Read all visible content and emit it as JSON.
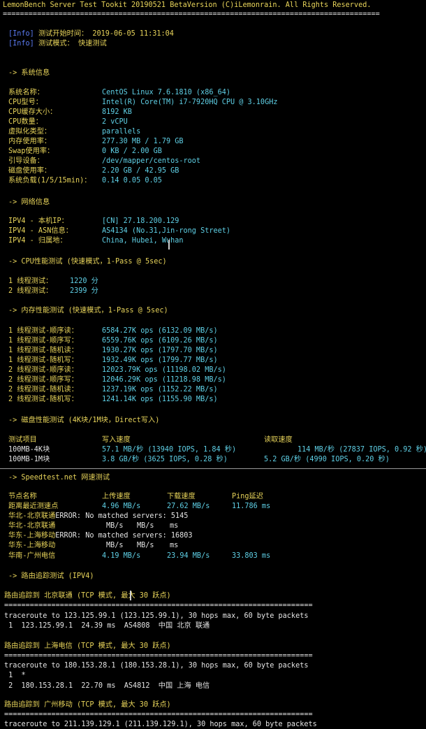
{
  "header": {
    "banner": "LemonBench Server Test Tookit 20190521 BetaVersion (C)iLemonrain. All Rights Reserved.",
    "divider": "========================================================================================"
  },
  "info": {
    "tag": "[Info] ",
    "start_label": "测试开始时间： ",
    "start_value": "2019-06-05 11:31:04",
    "mode_label": "测试模式： ",
    "mode_value": "快速测试"
  },
  "system": {
    "heading": "-> 系统信息",
    "rows": [
      {
        "label": "系统名称：",
        "value": "CentOS Linux 7.6.1810 (x86_64)"
      },
      {
        "label": "CPU型号：",
        "value": "Intel(R) Core(TM) i7-7920HQ CPU @ 3.10GHz"
      },
      {
        "label": "CPU缓存大小：",
        "value": "8192 KB"
      },
      {
        "label": "CPU数量：",
        "value": "2 vCPU"
      },
      {
        "label": "虚拟化类型：",
        "value": "parallels"
      },
      {
        "label": "内存使用率：",
        "value": "277.30 MB / 1.79 GB"
      },
      {
        "label": "Swap使用率：",
        "value": "0 KB / 2.00 GB"
      },
      {
        "label": "引导设备：",
        "value": "/dev/mapper/centos-root"
      },
      {
        "label": "磁盘使用率：",
        "value": "2.20 GB / 42.95 GB"
      },
      {
        "label": "系统负载(1/5/15min)：",
        "value": "0.14 0.05 0.05"
      }
    ]
  },
  "network": {
    "heading": "-> 网络信息",
    "rows": [
      {
        "label": "IPV4 - 本机IP：",
        "value": "[CN] 27.18.200.129"
      },
      {
        "label": "IPV4 - ASN信息：",
        "value": "AS4134 (No.31,Jin-rong Street)"
      },
      {
        "label": "IPV4 - 归属地：",
        "value": "China, Hubei, Wuhan"
      }
    ]
  },
  "cpu": {
    "heading": "-> CPU性能测试 (快速模式，1-Pass @ 5sec)",
    "rows": [
      {
        "label": "1 线程测试：",
        "value": "1220 分"
      },
      {
        "label": "2 线程测试：",
        "value": "2399 分"
      }
    ]
  },
  "memory": {
    "heading": "-> 内存性能测试 (快速模式，1-Pass @ 5sec)",
    "rows": [
      {
        "label": "1 线程测试-顺序读：",
        "value": "6584.27K ops (6132.09 MB/s)"
      },
      {
        "label": "1 线程测试-顺序写：",
        "value": "6559.76K ops (6109.26 MB/s)"
      },
      {
        "label": "1 线程测试-随机读：",
        "value": "1930.27K ops (1797.70 MB/s)"
      },
      {
        "label": "1 线程测试-随机写：",
        "value": "1932.49K ops (1799.77 MB/s)"
      },
      {
        "label": "2 线程测试-顺序读：",
        "value": "12023.79K ops (11198.02 MB/s)"
      },
      {
        "label": "2 线程测试-顺序写：",
        "value": "12046.29K ops (11218.98 MB/s)"
      },
      {
        "label": "2 线程测试-随机读：",
        "value": "1237.19K ops (1152.22 MB/s)"
      },
      {
        "label": "2 线程测试-随机写：",
        "value": "1241.14K ops (1155.90 MB/s)"
      }
    ]
  },
  "disk": {
    "heading": "-> 磁盘性能测试 (4K块/1M块，Direct写入)",
    "headers": [
      "测试项目",
      "写入速度",
      "读取速度"
    ],
    "rows": [
      {
        "item": "100MB-4K块",
        "write": "57.1 MB/秒 (13940 IOPS, 1.84 秒)",
        "read": "114 MB/秒 (27837 IOPS, 0.92 秒)"
      },
      {
        "item": "100MB-1M块",
        "write": "3.8 GB/秒 (3625 IOPS, 0.28 秒)",
        "read": "5.2 GB/秒 (4990 IOPS, 0.20 秒)"
      }
    ]
  },
  "speedtest": {
    "heading": "-> Speedtest.net 网速测试",
    "headers": [
      "节点名称",
      "上传速度",
      "下载速度",
      "Ping延迟"
    ],
    "rows": [
      {
        "node": "距离最近测速点",
        "upload": "4.96 MB/s",
        "download": "27.62 MB/s",
        "ping": "11.786 ms"
      },
      {
        "node": "华北-北京联通",
        "error": "ERROR: No matched servers: 5145"
      },
      {
        "node": "华北-北京联通",
        "upload": "MB/s",
        "download": "MB/s",
        "ping": "ms"
      },
      {
        "node": "华东-上海移动",
        "error": "ERROR: No matched servers: 16803"
      },
      {
        "node": "华东-上海移动",
        "upload": "MB/s",
        "download": "MB/s",
        "ping": "ms"
      },
      {
        "node": "华南-广州电信",
        "upload": "4.19 MB/s",
        "download": "23.94 MB/s",
        "ping": "33.803 ms"
      }
    ]
  },
  "traceroute": {
    "heading": "-> 路由追踪测试 (IPV4)",
    "divider": "========================================================================",
    "blocks": [
      {
        "title": "路由追踪到 北京联通 (TCP 模式, 最大 30 跃点)",
        "command": "traceroute to 123.125.99.1 (123.125.99.1), 30 hops max, 60 byte packets",
        "hops": [
          " 1  123.125.99.1  24.39 ms  AS4808  中国 北京 联通"
        ]
      },
      {
        "title": "路由追踪到 上海电信 (TCP 模式, 最大 30 跃点)",
        "command": "traceroute to 180.153.28.1 (180.153.28.1), 30 hops max, 60 byte packets",
        "hops": [
          " 1  *",
          " 2  180.153.28.1  22.70 ms  AS4812  中国 上海 电信"
        ]
      },
      {
        "title": "路由追踪到 广州移动 (TCP 模式, 最大 30 跃点)",
        "command": "traceroute to 211.139.129.1 (211.139.129.1), 30 hops max, 60 byte packets",
        "hops": []
      }
    ]
  }
}
